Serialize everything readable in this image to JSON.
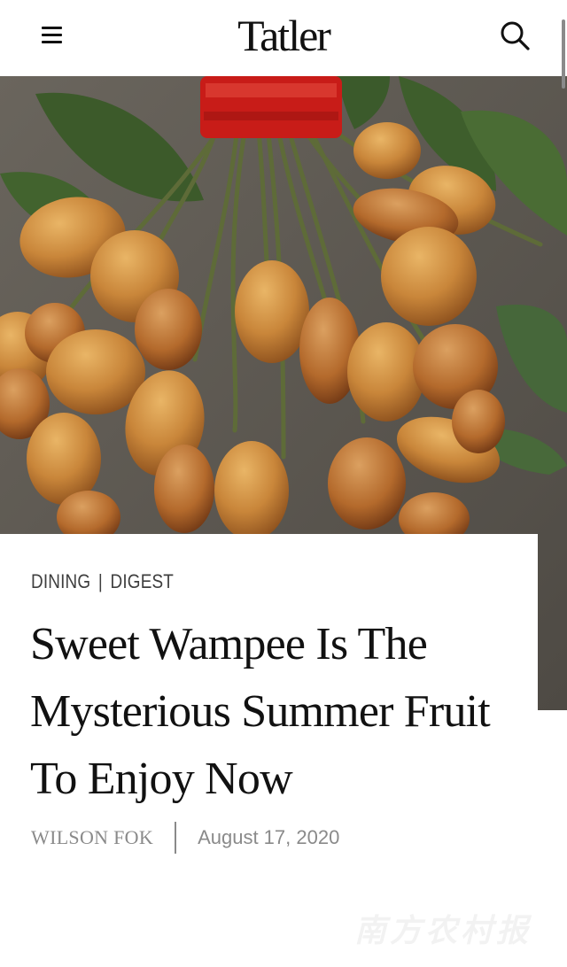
{
  "header": {
    "logo_text": "Tatler",
    "menu_icon": "hamburger-menu-icon",
    "search_icon": "search-icon"
  },
  "hero": {
    "subject": "hero-image"
  },
  "article": {
    "categories": [
      "DINING",
      "DIGEST"
    ],
    "category_separator": "|",
    "title": "Sweet Wampee Is The Mysterious Summer Fruit To Enjoy Now",
    "author": "WILSON FOK",
    "date": "August 17, 2020"
  },
  "watermark": {
    "text": "南方农村报"
  },
  "colors": {
    "text": "#111111",
    "muted": "#8a8a8a",
    "category": "#3e3e3e",
    "fruit": "#c98a3a",
    "ribbon": "#d0201c"
  }
}
